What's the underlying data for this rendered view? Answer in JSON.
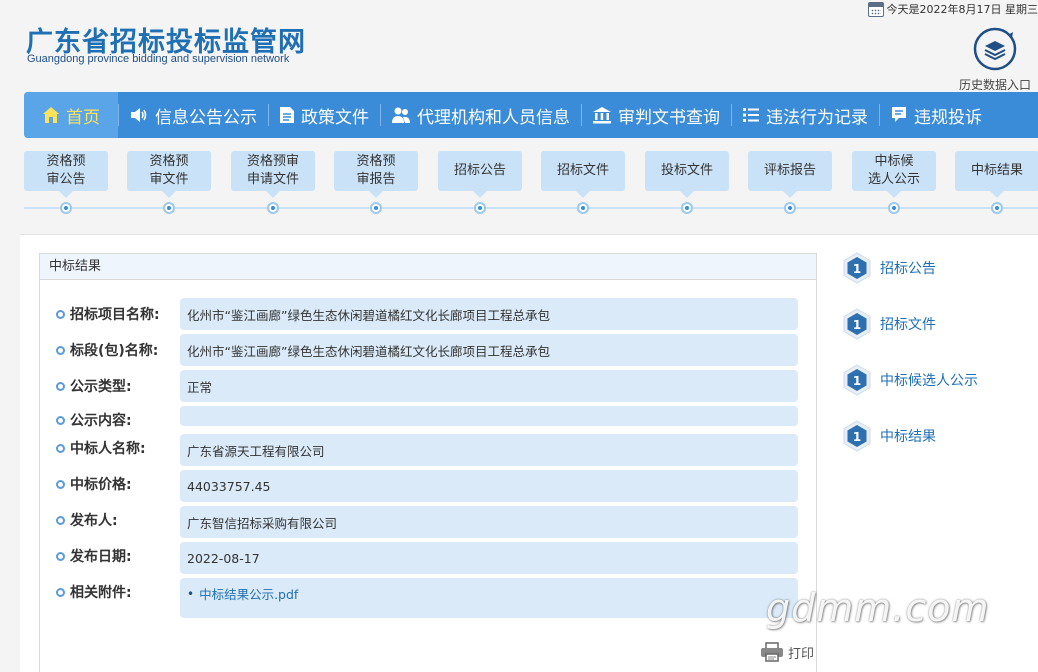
{
  "header": {
    "title": "广东省招标投标监管网",
    "subtitle": "Guangdong province bidding and supervision network",
    "date_text": "今天是2022年8月17日  星期三",
    "history_label": "历史数据入口"
  },
  "nav": {
    "items": [
      {
        "label": "首页",
        "icon": "home-icon",
        "active": true
      },
      {
        "label": "信息公告公示",
        "icon": "speaker-icon"
      },
      {
        "label": "政策文件",
        "icon": "document-icon"
      },
      {
        "label": "代理机构和人员信息",
        "icon": "people-icon"
      },
      {
        "label": "审判文书查询",
        "icon": "courthouse-icon"
      },
      {
        "label": "违法行为记录",
        "icon": "list-icon"
      },
      {
        "label": "违规投诉",
        "icon": "complaint-icon"
      }
    ]
  },
  "steps": [
    {
      "line1": "资格预",
      "line2": "审公告"
    },
    {
      "line1": "资格预",
      "line2": "审文件"
    },
    {
      "line1": "资格预审",
      "line2": "申请文件"
    },
    {
      "line1": "资格预",
      "line2": "审报告"
    },
    {
      "line1": "招标公告",
      "line2": ""
    },
    {
      "line1": "招标文件",
      "line2": ""
    },
    {
      "line1": "投标文件",
      "line2": ""
    },
    {
      "line1": "评标报告",
      "line2": ""
    },
    {
      "line1": "中标候",
      "line2": "选人公示"
    },
    {
      "line1": "中标结果",
      "line2": ""
    }
  ],
  "panel": {
    "title": "中标结果",
    "fields": [
      {
        "label": "招标项目名称:",
        "value": "化州市“鉴江画廊”绿色生态休闲碧道橘红文化长廊项目工程总承包"
      },
      {
        "label": "标段(包)名称:",
        "value": "化州市“鉴江画廊”绿色生态休闲碧道橘红文化长廊项目工程总承包"
      },
      {
        "label": "公示类型:",
        "value": "正常"
      },
      {
        "label": "公示内容:",
        "value": ""
      },
      {
        "label": "中标人名称:",
        "value": "广东省源天工程有限公司"
      },
      {
        "label": "中标价格:",
        "value": "44033757.45"
      },
      {
        "label": "发布人:",
        "value": "广东智信招标采购有限公司"
      },
      {
        "label": "发布日期:",
        "value": "2022-08-17"
      },
      {
        "label": "相关附件:",
        "value": "中标结果公示.pdf"
      }
    ],
    "print_label": "打印"
  },
  "sidebar": {
    "items": [
      {
        "label": "招标公告",
        "count": "1"
      },
      {
        "label": "招标文件",
        "count": "1"
      },
      {
        "label": "中标候选人公示",
        "count": "1"
      },
      {
        "label": "中标结果",
        "count": "1"
      }
    ]
  },
  "watermark": "gdmm.com",
  "colors": {
    "nav_bg": "#3b8cd8",
    "nav_active": "#5aa5e8",
    "step_bg": "#c9e2f7",
    "field_bg": "#daeaf8",
    "link": "#1f6fb5"
  }
}
